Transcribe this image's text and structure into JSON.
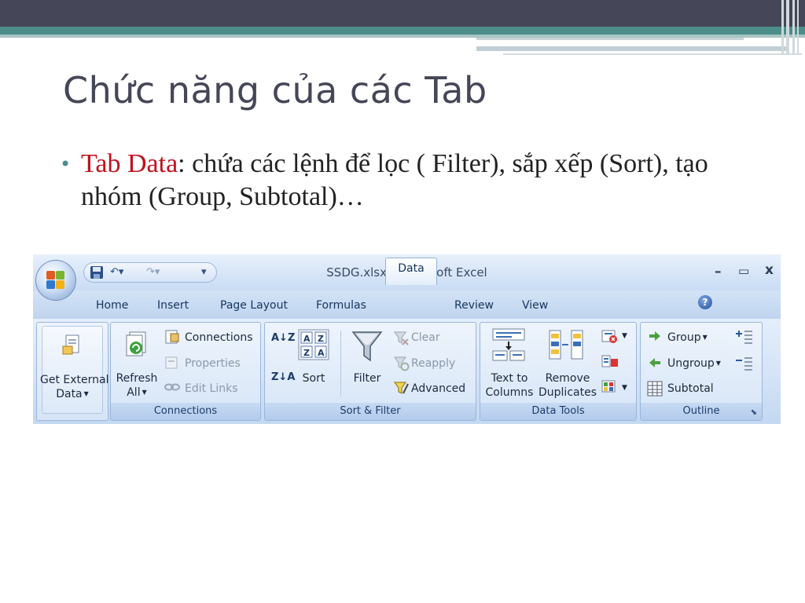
{
  "slide": {
    "title": "Chức năng của các Tab",
    "bullet": {
      "highlight": "Tab Data",
      "text": ": chứa các lệnh để lọc ( Filter), sắp xếp (Sort), tạo nhóm (Group, Subtotal)…"
    }
  },
  "excel": {
    "title": "SSDG.xlsx - Microsoft Excel",
    "window_controls": {
      "minimize": "–",
      "maximize": "▭",
      "close": "x"
    },
    "tabs": [
      "Home",
      "Insert",
      "Page Layout",
      "Formulas",
      "Data",
      "Review",
      "View"
    ],
    "active_tab": "Data",
    "help_glyph": "?",
    "groups": {
      "get_external": {
        "label_line1": "Get External",
        "label_line2": "Data"
      },
      "connections": {
        "label": "Connections",
        "refresh_line1": "Refresh",
        "refresh_line2": "All",
        "connections": "Connections",
        "properties": "Properties",
        "edit_links": "Edit Links"
      },
      "sort_filter": {
        "label": "Sort & Filter",
        "sort_az": "A↓Z",
        "sort_za": "Z↓A",
        "sort": "Sort",
        "filter": "Filter",
        "clear": "Clear",
        "reapply": "Reapply",
        "advanced": "Advanced"
      },
      "data_tools": {
        "label": "Data Tools",
        "text_to_columns_line1": "Text to",
        "text_to_columns_line2": "Columns",
        "remove_duplicates_line1": "Remove",
        "remove_duplicates_line2": "Duplicates"
      },
      "outline": {
        "label": "Outline",
        "group": "Group",
        "ungroup": "Ungroup",
        "subtotal": "Subtotal"
      }
    }
  },
  "colors": {
    "slide_band": "#454657",
    "slide_teal": "#4c8d8a",
    "highlight": "#c0111b",
    "ribbon_blue": "#c7daf2"
  }
}
